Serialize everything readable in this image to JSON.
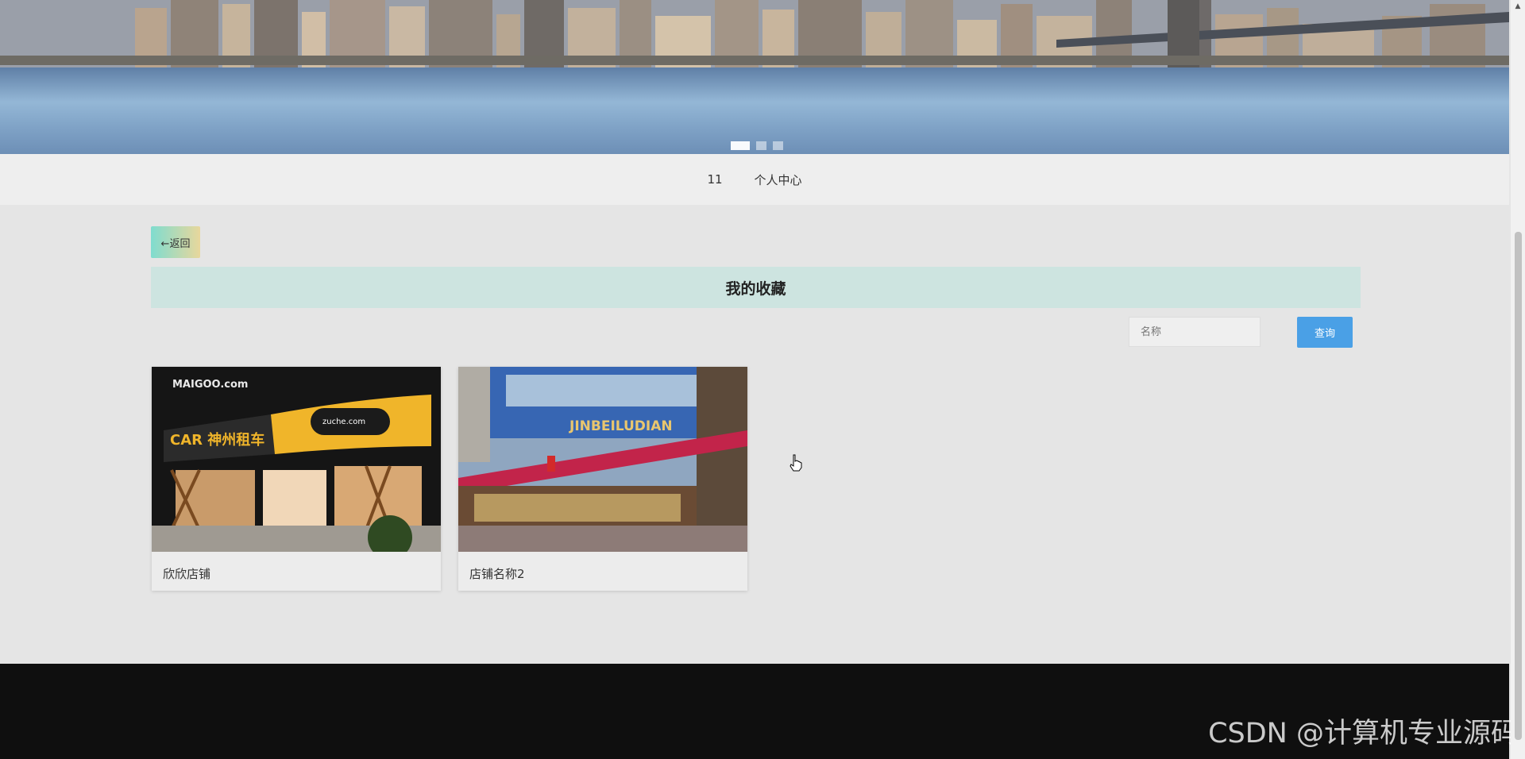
{
  "banner": {
    "indicators": [
      {
        "active": true
      },
      {
        "active": false
      },
      {
        "active": false
      }
    ]
  },
  "nav": {
    "items": [
      {
        "label": "11"
      },
      {
        "label": "个人中心"
      }
    ]
  },
  "back_button": {
    "label": "←返回"
  },
  "page_title": "我的收藏",
  "search": {
    "placeholder": "名称",
    "button_label": "查询"
  },
  "favorites": [
    {
      "name": "欣欣店铺",
      "image": "car-rental-storefront-image"
    },
    {
      "name": "店铺名称2",
      "image": "market-storefront-image"
    }
  ],
  "colors": {
    "accent_blue": "#4aa0e6",
    "title_bar_bg": "#cde4e0",
    "back_gradient_start": "#7fdccf",
    "back_gradient_end": "#e8d79c",
    "footer_bg": "#0f0f0f"
  },
  "watermark": "CSDN @计算机专业源码"
}
